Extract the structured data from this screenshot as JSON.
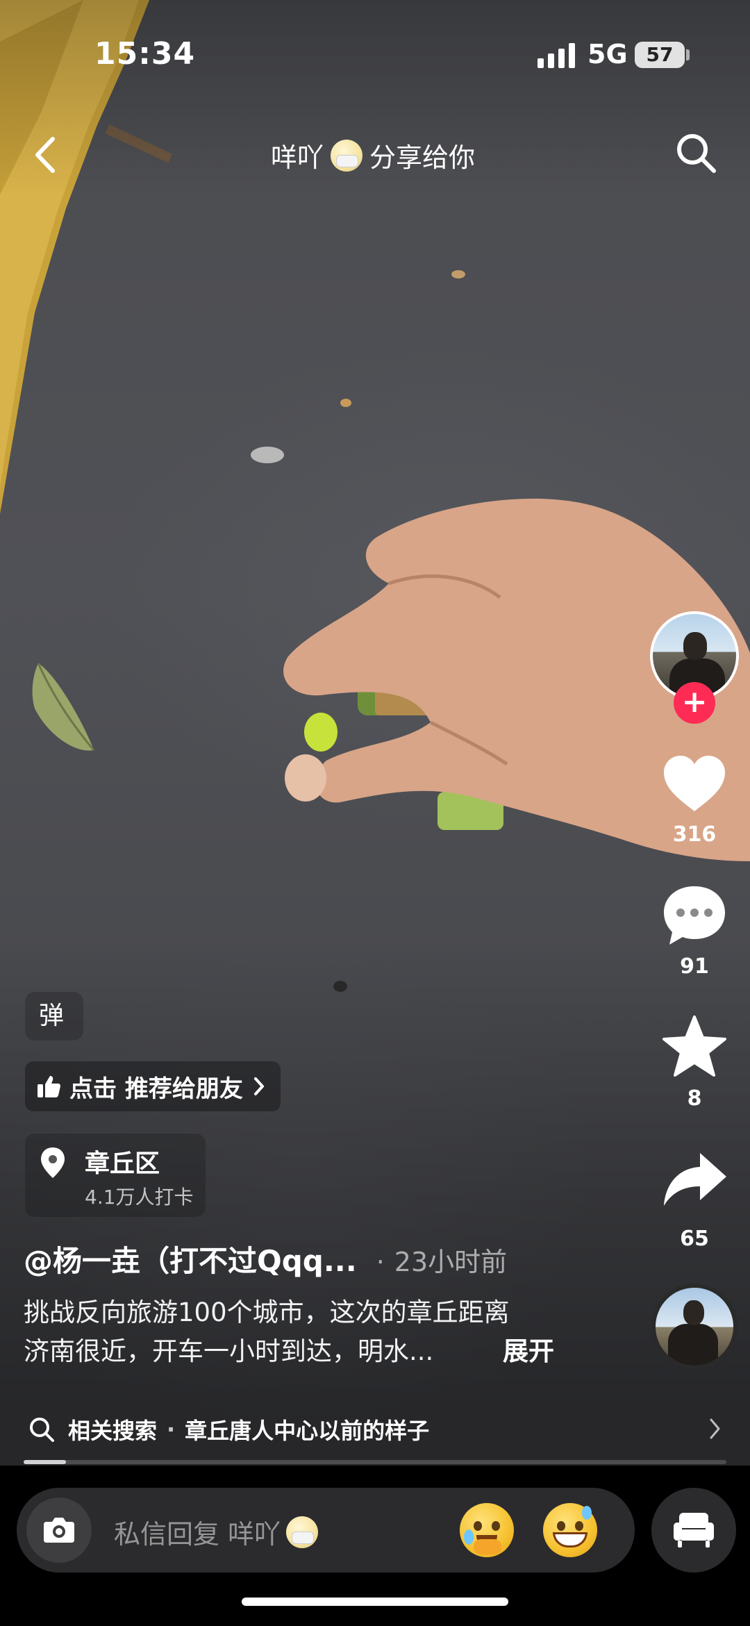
{
  "status_bar": {
    "time": "15:34",
    "network": "5G",
    "battery": "57"
  },
  "nav": {
    "share_sender": "咩吖",
    "share_text": "分享给你"
  },
  "rail": {
    "like_count": "316",
    "comment_count": "91",
    "favorite_count": "8",
    "share_count": "65",
    "follow_symbol": "+"
  },
  "overlay": {
    "danmu_label": "弹",
    "recommend_label": "点击 推荐给朋友",
    "location_name": "章丘区",
    "location_checkins": "4.1万人打卡",
    "author": "@杨一垚（打不过Qqq...",
    "time_ago": "23小时前",
    "description_line1": "挑战反向旅游100个城市，这次的章丘距离",
    "description_line2": "济南很近，开车一小时到达，明水...",
    "expand_label": "展开"
  },
  "related_search": {
    "label": "相关搜索",
    "query": "章丘唐人中心以前的样子"
  },
  "playback": {
    "progress": 0.06
  },
  "composer": {
    "placeholder": "私信回复 咩吖"
  },
  "colors": {
    "follow_red": "#fe2c55",
    "background": "#000000"
  },
  "icons": [
    "back-icon",
    "search-icon",
    "heart-icon",
    "comment-icon",
    "star-icon",
    "share-icon",
    "thumb-up-icon",
    "location-pin-icon",
    "camera-icon",
    "sofa-icon",
    "chevron-right-icon"
  ]
}
